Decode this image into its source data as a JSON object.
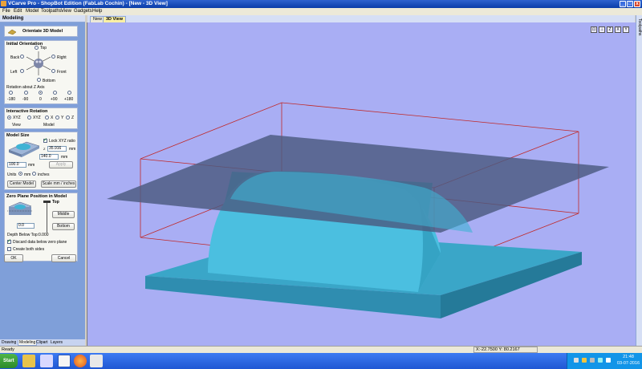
{
  "window": {
    "title": "VCarve Pro - ShopBot Edition (FabLab Cochin) - [New - 3D View]",
    "controls": [
      "_",
      "□",
      "x"
    ]
  },
  "menu": [
    "File",
    "Edit",
    "Model",
    "Toolpaths",
    "View",
    "Gadgets",
    "Help"
  ],
  "left_panel": {
    "header": "Modeling",
    "orientate": {
      "label": "Orientate 3D Model"
    },
    "initial_orientation": {
      "title": "Initial Orientation",
      "top": "Top",
      "back": "Back",
      "right": "Right",
      "left": "Left",
      "front": "Front",
      "bottom": "Bottom",
      "rotation_label": "Rotation about Z Axis",
      "angles": [
        "-180",
        "-90",
        "0",
        "+90",
        "+180"
      ],
      "selected_angle": "0"
    },
    "interactive_rotation": {
      "title": "Interactive Rotation",
      "options": [
        "XYZ",
        "XYZ",
        "X",
        "Y",
        "Z"
      ],
      "selected": 0,
      "sub_labels": [
        "View",
        "Model"
      ]
    },
    "model_size": {
      "title": "Model Size",
      "lock_label": "Lock XYZ ratio",
      "lock_checked": true,
      "z_value": "35.916",
      "z_unit": "mm",
      "y_value": "140.0",
      "y_unit": "mm",
      "x_value": "100.0",
      "x_unit": "mm",
      "apply_label": "Apply",
      "units_label": "Units",
      "unit_mm": "mm",
      "unit_inches": "inches",
      "selected_unit": "mm",
      "center_model_label": "Center Model",
      "scale_label": "Scale mm / inches"
    },
    "zero_plane": {
      "title": "Zero Plane Position in Model",
      "top_label": "Top",
      "middle_label": "Middle",
      "bottom_label": "Bottom",
      "value": "0.0",
      "depth_label": "Depth Below Top:",
      "depth_value": "0.000",
      "discard_label": "Discard data below zero plane",
      "discard_checked": true,
      "create_both_label": "Create both sides",
      "create_both_checked": false
    },
    "ok_label": "OK",
    "cancel_label": "Cancel",
    "tabs": [
      "Drawing",
      "Modeling",
      "Clipart",
      "Layers"
    ],
    "active_tab": "Modeling"
  },
  "document_tabs": [
    "New",
    "3D View"
  ],
  "active_document_tab": "3D View",
  "view_tools": [
    "zoom-extents-icon",
    "iso-view-icon",
    "top-view-icon",
    "x-view-icon",
    "y-view-icon"
  ],
  "view_tool_glyphs": [
    "⊡",
    "⊥",
    "Z",
    "X",
    "Y"
  ],
  "right_strip_label": "Toolpaths",
  "status": {
    "ready": "Ready",
    "coords": "X:-22.7500 Y: 80.2167"
  },
  "taskbar": {
    "start_label": "Start",
    "time": "21:48",
    "date": "03-07-2016"
  },
  "colors": {
    "viewport_bg": "#a9aef4",
    "model": "#3fb3d4",
    "base": "#3aa6c8",
    "bounding_box": "#c02828",
    "zero_plane": "#4a5a80"
  }
}
